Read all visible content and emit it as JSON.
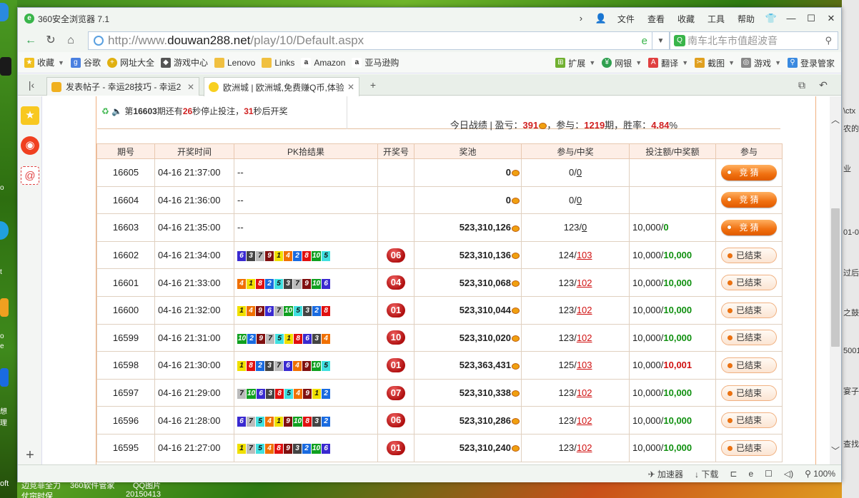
{
  "window": {
    "title": "360安全浏览器 7.1",
    "menu": [
      "文件",
      "查看",
      "收藏",
      "工具",
      "帮助"
    ]
  },
  "address": {
    "url_prefix": "http://www.",
    "url_domain": "douwan288.net",
    "url_path": "/play/10/Default.aspx",
    "search_placeholder": "南车北车市值超波音"
  },
  "favorites": {
    "items": [
      {
        "label": "收藏",
        "icon": "star-icon",
        "has_arrow": true
      },
      {
        "label": "谷歌",
        "icon": "google-icon"
      },
      {
        "label": "网址大全",
        "icon": "site-directory-icon"
      },
      {
        "label": "游戏中心",
        "icon": "gamepad-icon"
      },
      {
        "label": "Lenovo",
        "icon": "folder-icon"
      },
      {
        "label": "Links",
        "icon": "folder-icon"
      },
      {
        "label": "Amazon",
        "icon": "amazon-icon"
      },
      {
        "label": "亚马逊购",
        "icon": "amazon-icon"
      }
    ],
    "right_items": [
      {
        "label": "扩展",
        "icon": "extensions-icon"
      },
      {
        "label": "网银",
        "icon": "bank-icon"
      },
      {
        "label": "翻译",
        "icon": "translate-icon"
      },
      {
        "label": "截图",
        "icon": "screenshot-icon"
      },
      {
        "label": "游戏",
        "icon": "game-icon"
      },
      {
        "label": "登录管家",
        "icon": "login-manager-icon"
      }
    ]
  },
  "tabs": [
    {
      "label": "发表帖子 - 幸运28技巧 - 幸运2",
      "active": false
    },
    {
      "label": "欧洲城 | 欧洲城,免费赚Q币,体验",
      "active": true
    }
  ],
  "status_bar": [
    "加速器",
    "下载",
    "100%"
  ],
  "info": {
    "countdown_prefix": "第",
    "period": "16603",
    "mid1": "期还有",
    "stop_seconds": "26",
    "mid2": "秒停止投注，",
    "open_seconds": "31",
    "suffix": "秒后开奖",
    "today_prefix": "今日战绩 | 盈亏：",
    "profit": "391",
    "today_mid": "，参与：",
    "participation": "1219",
    "today_mid2": "期，胜率：",
    "win_rate": "4.84",
    "win_rate_unit": "%"
  },
  "table": {
    "headers": [
      "期号",
      "开奖时间",
      "PK拾结果",
      "开奖号",
      "奖池",
      "参与/中奖",
      "投注额/中奖额",
      "参与"
    ],
    "rows": [
      {
        "period": "16605",
        "time": "04-16  21:37:00",
        "result": "--",
        "balls": [],
        "draw": "",
        "pool": "0",
        "join": "0",
        "win": "0",
        "bet": "",
        "prize": "",
        "action": "竞 猜",
        "open": true,
        "win_link": false,
        "prize_color": "g"
      },
      {
        "period": "16604",
        "time": "04-16  21:36:00",
        "result": "--",
        "balls": [],
        "draw": "",
        "pool": "0",
        "join": "0",
        "win": "0",
        "bet": "",
        "prize": "",
        "action": "竞 猜",
        "open": true,
        "win_link": false,
        "prize_color": "g"
      },
      {
        "period": "16603",
        "time": "04-16  21:35:00",
        "result": "--",
        "balls": [],
        "draw": "",
        "pool": "523,310,126",
        "join": "123",
        "win": "0",
        "bet": "10,000/",
        "prize": "0",
        "action": "竞 猜",
        "open": true,
        "win_link": false,
        "prize_color": "g"
      },
      {
        "period": "16602",
        "time": "04-16  21:34:00",
        "result": "",
        "balls": [
          "6",
          "3",
          "7",
          "9",
          "1",
          "4",
          "2",
          "8",
          "10",
          "5"
        ],
        "draw": "06",
        "pool": "523,310,136",
        "join": "124",
        "win": "103",
        "bet": "10,000/",
        "prize": "10,000",
        "action": "已结束",
        "open": false,
        "win_link": true,
        "prize_color": "g"
      },
      {
        "period": "16601",
        "time": "04-16  21:33:00",
        "result": "",
        "balls": [
          "4",
          "1",
          "8",
          "2",
          "5",
          "3",
          "7",
          "9",
          "10",
          "6"
        ],
        "draw": "04",
        "pool": "523,310,068",
        "join": "123",
        "win": "102",
        "bet": "10,000/",
        "prize": "10,000",
        "action": "已结束",
        "open": false,
        "win_link": true,
        "prize_color": "g"
      },
      {
        "period": "16600",
        "time": "04-16  21:32:00",
        "result": "",
        "balls": [
          "1",
          "4",
          "9",
          "6",
          "7",
          "10",
          "5",
          "3",
          "2",
          "8"
        ],
        "draw": "01",
        "pool": "523,310,044",
        "join": "123",
        "win": "102",
        "bet": "10,000/",
        "prize": "10,000",
        "action": "已结束",
        "open": false,
        "win_link": true,
        "prize_color": "g"
      },
      {
        "period": "16599",
        "time": "04-16  21:31:00",
        "result": "",
        "balls": [
          "10",
          "2",
          "9",
          "7",
          "5",
          "1",
          "8",
          "6",
          "3",
          "4"
        ],
        "draw": "10",
        "pool": "523,310,020",
        "join": "123",
        "win": "102",
        "bet": "10,000/",
        "prize": "10,000",
        "action": "已结束",
        "open": false,
        "win_link": true,
        "prize_color": "g"
      },
      {
        "period": "16598",
        "time": "04-16  21:30:00",
        "result": "",
        "balls": [
          "1",
          "8",
          "2",
          "3",
          "7",
          "6",
          "4",
          "9",
          "10",
          "5"
        ],
        "draw": "01",
        "pool": "523,363,431",
        "join": "125",
        "win": "103",
        "bet": "10,000/",
        "prize": "10,001",
        "action": "已结束",
        "open": false,
        "win_link": true,
        "prize_color": "rd"
      },
      {
        "period": "16597",
        "time": "04-16  21:29:00",
        "result": "",
        "balls": [
          "7",
          "10",
          "6",
          "3",
          "8",
          "5",
          "4",
          "9",
          "1",
          "2"
        ],
        "draw": "07",
        "pool": "523,310,338",
        "join": "123",
        "win": "102",
        "bet": "10,000/",
        "prize": "10,000",
        "action": "已结束",
        "open": false,
        "win_link": true,
        "prize_color": "g"
      },
      {
        "period": "16596",
        "time": "04-16  21:28:00",
        "result": "",
        "balls": [
          "6",
          "7",
          "5",
          "4",
          "1",
          "9",
          "10",
          "8",
          "3",
          "2"
        ],
        "draw": "06",
        "pool": "523,310,286",
        "join": "123",
        "win": "102",
        "bet": "10,000/",
        "prize": "10,000",
        "action": "已结束",
        "open": false,
        "win_link": true,
        "prize_color": "g"
      },
      {
        "period": "16595",
        "time": "04-16  21:27:00",
        "result": "",
        "balls": [
          "1",
          "7",
          "5",
          "4",
          "8",
          "9",
          "3",
          "2",
          "10",
          "6"
        ],
        "draw": "01",
        "pool": "523,310,240",
        "join": "123",
        "win": "102",
        "bet": "10,000/",
        "prize": "10,000",
        "action": "已结束",
        "open": false,
        "win_link": true,
        "prize_color": "g"
      }
    ]
  },
  "ball_colors": {
    "1": "#f0e000",
    "2": "#1a6be0",
    "3": "#444444",
    "4": "#f07000",
    "5": "#40e0e0",
    "6": "#3a2ad0",
    "7": "#bbbbbb",
    "8": "#e01010",
    "9": "#801010",
    "10": "#10a020"
  },
  "desktop": {
    "taskbar_labels": [
      "oft",
      "边竞菲全力",
      "360软件管家",
      "QQ图片"
    ],
    "taskbar_labels_2": [
      "仗帘时保",
      "20150413"
    ],
    "left_labels": [
      "o",
      "t",
      "o",
      "e",
      "想",
      "理"
    ],
    "right_labels": [
      "\\ctx",
      "农的",
      "业",
      "01-0",
      "过后",
      "之鼓",
      "5001",
      "宴子",
      "查找"
    ]
  }
}
